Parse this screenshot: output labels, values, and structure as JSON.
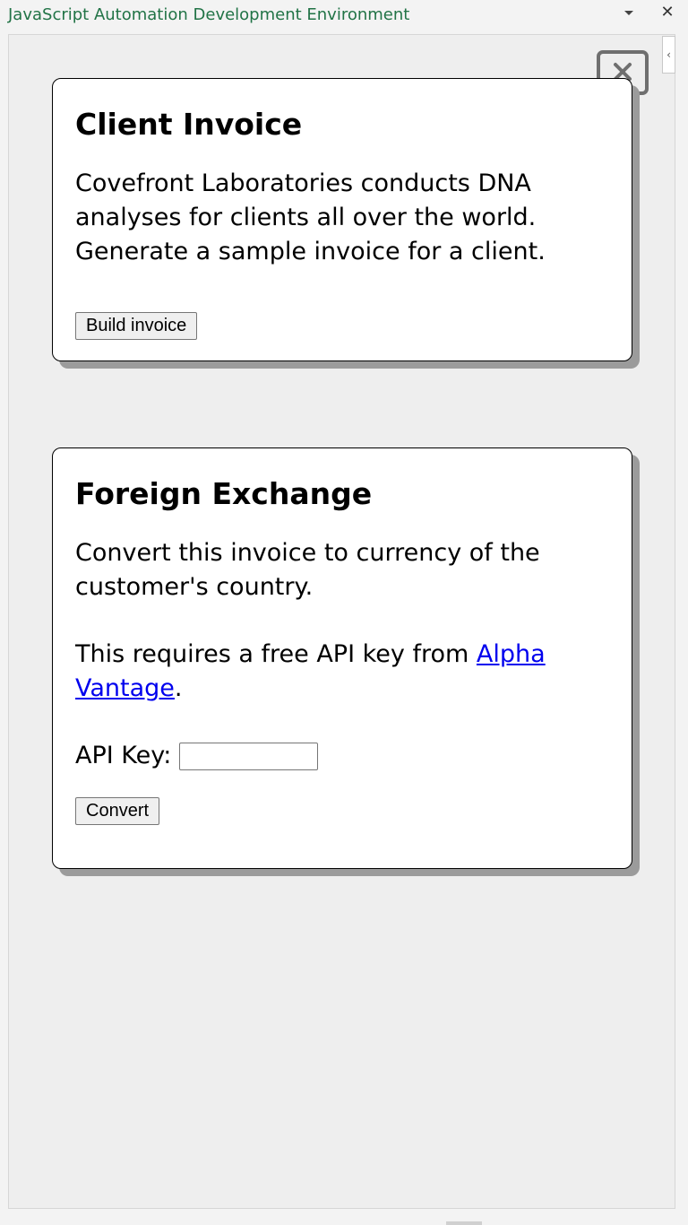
{
  "window": {
    "title": "JavaScript Automation Development Environment",
    "accent_color": "#217346",
    "close_glyph": "✕",
    "collapse_glyph": "‹"
  },
  "cards": [
    {
      "heading": "Client Invoice",
      "description": "Covefront Laboratories conducts DNA analyses for clients all over the world. Generate a sample invoice for a client.",
      "button_label": "Build invoice"
    },
    {
      "heading": "Foreign Exchange",
      "description": "Convert this invoice to currency of the customer's country.",
      "api_note_prefix": "This requires a free API key from ",
      "api_link_text": "Alpha Vantage",
      "api_note_suffix": ".",
      "api_key_label": "API Key:",
      "api_key_value": "",
      "button_label": "Convert"
    }
  ],
  "icons": {
    "dropdown": "chevron-down-icon",
    "pane_close": "close-icon",
    "collapse": "chevron-left-icon",
    "dismiss": "close-box-icon"
  }
}
